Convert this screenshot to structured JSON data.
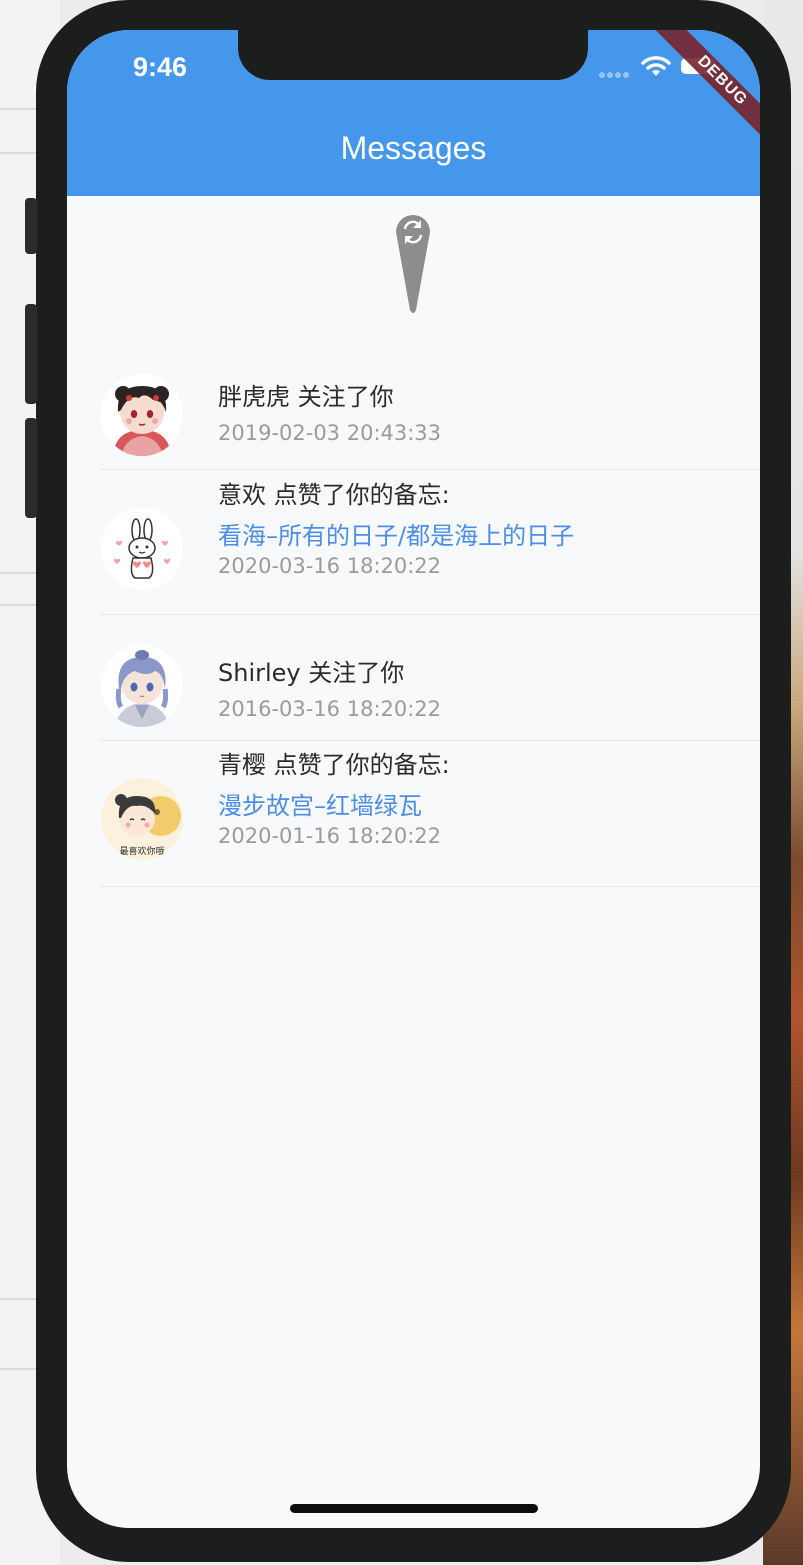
{
  "status_bar": {
    "time": "9:46",
    "debug_banner": "DEBUG"
  },
  "app_bar": {
    "title": "Messages"
  },
  "colors": {
    "app_bar": "#4497ea",
    "link": "#4b8de8",
    "timestamp": "#9b9b9b"
  },
  "messages": [
    {
      "text": "胖虎虎 关注了你",
      "link": "",
      "time": "2019-02-03 20:43:33",
      "avatar": "girl-red-dress-avatar"
    },
    {
      "text": "意欢 点赞了你的备忘:",
      "link": "看海–所有的日子/都是海上的日子",
      "time": "2020-03-16 18:20:22",
      "avatar": "bunny-hearts-avatar"
    },
    {
      "text": "Shirley 关注了你",
      "link": "",
      "time": "2016-03-16 18:20:22",
      "avatar": "blue-hair-boy-avatar"
    },
    {
      "text": "青樱 点赞了你的备忘:",
      "link": "漫步故宫–红墙绿瓦",
      "time": "2020-01-16 18:20:22",
      "avatar": "yellow-girl-avatar",
      "avatar_caption": "最喜欢你哦"
    }
  ]
}
